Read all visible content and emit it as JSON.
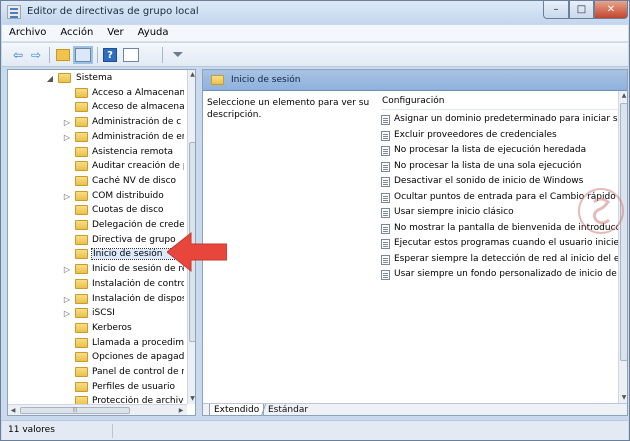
{
  "window": {
    "title": "Editor de directivas de grupo local",
    "min_label": "–",
    "max_label": "□",
    "close_label": "✕"
  },
  "menu": [
    {
      "label": "Archivo"
    },
    {
      "label": "Acción"
    },
    {
      "label": "Ver"
    },
    {
      "label": "Ayuda"
    }
  ],
  "toolbar": {
    "back_glyph": "⇦",
    "forward_glyph": "⇨",
    "help_glyph": "?",
    "filter_glyph": "⏷"
  },
  "tree": {
    "items": [
      {
        "label": "Sistema",
        "expander": "◢"
      },
      {
        "label": "Acceso a Almacenam",
        "expander": ""
      },
      {
        "label": "Acceso de almacenar",
        "expander": ""
      },
      {
        "label": "Administración de c",
        "expander": "▷"
      },
      {
        "label": "Administración de er",
        "expander": "▷"
      },
      {
        "label": "Asistencia remota",
        "expander": ""
      },
      {
        "label": "Auditar creación de p",
        "expander": ""
      },
      {
        "label": "Caché NV de disco",
        "expander": ""
      },
      {
        "label": "COM distribuido",
        "expander": "▷"
      },
      {
        "label": "Cuotas de disco",
        "expander": ""
      },
      {
        "label": "Delegación de creder",
        "expander": ""
      },
      {
        "label": "Directiva de grupo",
        "expander": ""
      },
      {
        "label": "Inicio de sesión",
        "expander": ""
      },
      {
        "label": "Inicio de sesión de re",
        "expander": "▷"
      },
      {
        "label": "Instalación de contro",
        "expander": ""
      },
      {
        "label": "Instalación de dispos",
        "expander": "▷"
      },
      {
        "label": "iSCSI",
        "expander": "▷"
      },
      {
        "label": "Kerberos",
        "expander": ""
      },
      {
        "label": "Llamada a procedimi",
        "expander": ""
      },
      {
        "label": "Opciones de apagado",
        "expander": ""
      },
      {
        "label": "Panel de control de r",
        "expander": ""
      },
      {
        "label": "Perfiles de usuario",
        "expander": ""
      },
      {
        "label": "Protección de archivo",
        "expander": ""
      }
    ],
    "selected_label": "Inicio de sesión"
  },
  "details": {
    "header_title": "Inicio de sesión",
    "description": "Seleccione un elemento para ver su descripción.",
    "column_header": "Configuración",
    "policies": [
      "Asignar un dominio predeterminado para iniciar sesión",
      "Excluir proveedores de credenciales",
      "No procesar la lista de ejecución heredada",
      "No procesar la lista de una sola ejecución",
      "Desactivar el sonido de inicio de Windows",
      "Ocultar puntos de entrada para el Cambio rápido de usuario",
      "Usar siempre inicio clásico",
      "No mostrar la pantalla de bienvenida de introducción",
      "Ejecutar estos programas cuando el usuario inicie la sesión",
      "Esperar siempre la detección de red al inicio del equipo",
      "Usar siempre un fondo personalizado de inicio de sesión"
    ],
    "tabs": [
      "Extendido",
      "Estándar"
    ]
  },
  "status": {
    "text": "11 valores"
  },
  "colors": {
    "accent_arrow": "#e8453c",
    "selection": "#dbe9f9"
  }
}
